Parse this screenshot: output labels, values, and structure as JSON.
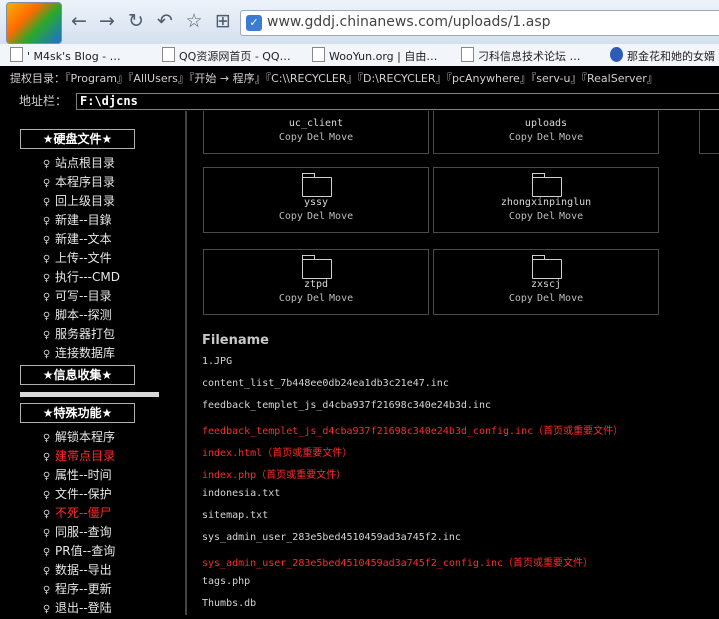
{
  "browser": {
    "url": "www.gddj.chinanews.com/uploads/1.asp",
    "nav": {
      "back": "←",
      "forward": "→",
      "refresh": "↻",
      "undo": "↶",
      "favorite": "☆",
      "tools": "⊞"
    }
  },
  "bookmarks": [
    "'  M4sk's Blog - …",
    "QQ资源网首页 - QQ…",
    "WooYun.org | 自由…",
    "刁科信息技术论坛 …",
    "那金花和她的女婿"
  ],
  "perm_bar": {
    "label": "提权目录：",
    "links": [
      "『Program』",
      "『AllUsers』",
      "『开始 → 程序』",
      "『C:\\\\RECYCLER』",
      "『D:\\RECYCLER』",
      "『pcAnywhere』",
      "『serv-u』",
      "『RealServer』"
    ]
  },
  "path_bar": {
    "label": "地址栏：",
    "value": "F:\\djcns"
  },
  "sidebar": {
    "disk_title": "★硬盘文件★",
    "disk_items": [
      "站点根目录",
      "本程序目录",
      "回上级目录",
      "新建--目錄",
      "新建--文本",
      "上传--文件",
      "执行---CMD",
      "可写--目录",
      "脚本--探测",
      "服务器打包",
      "连接数据库"
    ],
    "info_title": "★信息收集★",
    "special_title": "★特殊功能★",
    "special_items": [
      {
        "label": "解锁本程序",
        "red": false
      },
      {
        "label": "建帯点目录",
        "red": true
      },
      {
        "label": "属性--时间",
        "red": false
      },
      {
        "label": "文件--保护",
        "red": false
      },
      {
        "label": "不死--僵尸",
        "red": true
      },
      {
        "label": "同服--查询",
        "red": false
      },
      {
        "label": "PR值--查询",
        "red": false
      },
      {
        "label": "数据--导出",
        "red": false
      },
      {
        "label": "程序--更新",
        "red": false
      },
      {
        "label": "退出--登陆",
        "red": false
      }
    ]
  },
  "folder_actions": {
    "copy": "Copy",
    "del": "Del",
    "move": "Move"
  },
  "folders": [
    "uc_client",
    "uploads",
    "yssy",
    "zhongxinpinglun",
    "ztpd",
    "zxscj"
  ],
  "files_heading": "Filename",
  "files": [
    {
      "name": "1.JPG",
      "red": false
    },
    {
      "name": "content_list_7b448ee0db24ea1db3c21e47.inc",
      "red": false
    },
    {
      "name": "feedback_templet_js_d4cba937f21698c340e24b3d.inc",
      "red": false
    },
    {
      "name": "feedback_templet_js_d4cba937f21698c340e24b3d_config.inc（首页或重要文件）",
      "red": true
    },
    {
      "name": "index.html（首页或重要文件）",
      "red": true
    },
    {
      "name": "index.php（首页或重要文件）",
      "red": true
    },
    {
      "name": "indonesia.txt",
      "red": false
    },
    {
      "name": "sitemap.txt",
      "red": false
    },
    {
      "name": "sys_admin_user_283e5bed4510459ad3a745f2.inc",
      "red": false
    },
    {
      "name": "sys_admin_user_283e5bed4510459ad3a745f2_config.inc（首页或重要文件）",
      "red": true
    },
    {
      "name": "tags.php",
      "red": false
    },
    {
      "name": "Thumbs.db",
      "red": false
    }
  ]
}
